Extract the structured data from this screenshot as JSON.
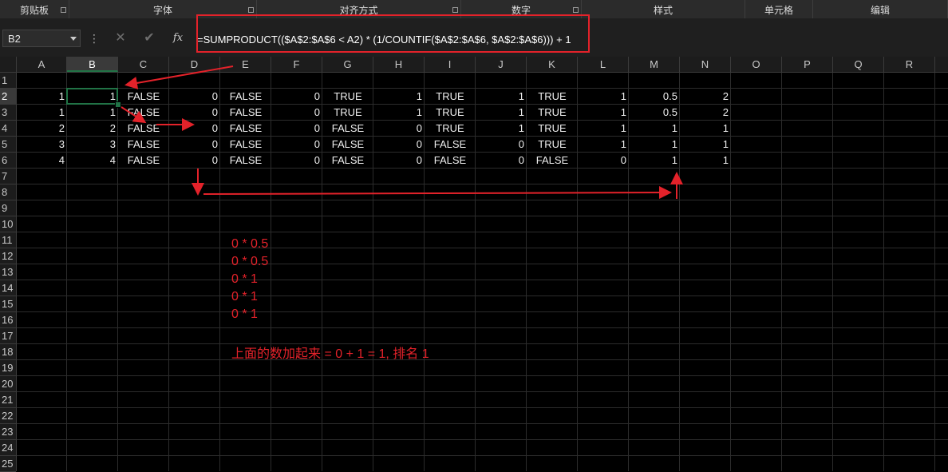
{
  "ribbon": {
    "groups": [
      {
        "label": "剪贴板",
        "expander": true
      },
      {
        "label": "字体",
        "expander": true
      },
      {
        "label": "对齐方式",
        "expander": true
      },
      {
        "label": "数字",
        "expander": true
      },
      {
        "label": "样式",
        "expander": false
      },
      {
        "label": "单元格",
        "expander": false
      },
      {
        "label": "编辑",
        "expander": false
      }
    ]
  },
  "formula_bar": {
    "name_box": "B2",
    "cancel_icon": "close-icon",
    "enter_icon": "check-icon",
    "function_icon": "fx",
    "formula": "=SUMPRODUCT(($A$2:$A$6 < A2) * (1/COUNTIF($A$2:$A$6, $A$2:$A$6))) + 1"
  },
  "columns": [
    "A",
    "B",
    "C",
    "D",
    "E",
    "F",
    "G",
    "H",
    "I",
    "J",
    "K",
    "L",
    "M",
    "N",
    "O",
    "P",
    "Q",
    "R"
  ],
  "selected_column": "B",
  "rows": [
    "1",
    "2",
    "3",
    "4",
    "5",
    "6",
    "7",
    "8",
    "9",
    "10",
    "11",
    "12",
    "13",
    "14",
    "15",
    "16",
    "17",
    "18",
    "19",
    "20",
    "21",
    "22",
    "23",
    "24",
    "25"
  ],
  "selected_row": "2",
  "cells": [
    [
      "",
      "",
      "",
      "",
      "",
      "",
      "",
      "",
      "",
      "",
      "",
      "",
      "",
      ""
    ],
    [
      "1",
      "1",
      "FALSE",
      "0",
      "FALSE",
      "0",
      "TRUE",
      "1",
      "TRUE",
      "1",
      "TRUE",
      "1",
      "0.5",
      "2"
    ],
    [
      "1",
      "1",
      "FALSE",
      "0",
      "FALSE",
      "0",
      "TRUE",
      "1",
      "TRUE",
      "1",
      "TRUE",
      "1",
      "0.5",
      "2"
    ],
    [
      "2",
      "2",
      "FALSE",
      "0",
      "FALSE",
      "0",
      "FALSE",
      "0",
      "TRUE",
      "1",
      "TRUE",
      "1",
      "1",
      "1"
    ],
    [
      "3",
      "3",
      "FALSE",
      "0",
      "FALSE",
      "0",
      "FALSE",
      "0",
      "FALSE",
      "0",
      "TRUE",
      "1",
      "1",
      "1"
    ],
    [
      "4",
      "4",
      "FALSE",
      "0",
      "FALSE",
      "0",
      "FALSE",
      "0",
      "FALSE",
      "0",
      "FALSE",
      "0",
      "1",
      "1"
    ]
  ],
  "annotations": {
    "lines": [
      "0 * 0.5",
      "0 * 0.5",
      "0 * 1",
      "0 * 1",
      "0 * 1"
    ],
    "summary": "上面的数加起来 = 0 + 1 = 1, 排名 1",
    "color": "#e3222a"
  },
  "colors": {
    "accent": "#217346",
    "highlight": "#e3222a",
    "background": "#000000"
  }
}
